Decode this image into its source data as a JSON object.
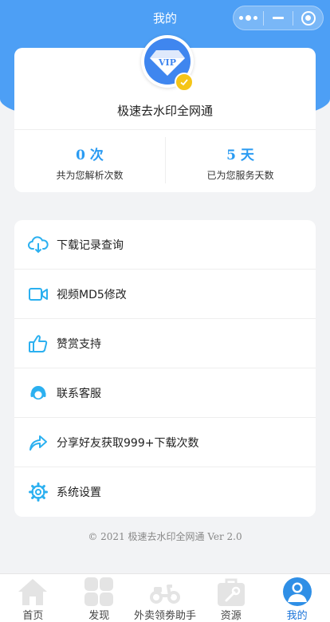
{
  "navbar": {
    "title": "我的",
    "menu_icon": "more-dots-icon",
    "minimize_icon": "minimize-icon",
    "close_icon": "target-close-icon"
  },
  "profile": {
    "badge_text": "VIP",
    "username": "极速去水印全网通",
    "stats": [
      {
        "value": "0 次",
        "label": "共为您解析次数"
      },
      {
        "value": "5 天",
        "label": "已为您服务天数"
      }
    ]
  },
  "menu": {
    "items": [
      {
        "label": "下载记录查询",
        "icon": "cloud-download-icon"
      },
      {
        "label": "视频MD5修改",
        "icon": "video-camera-icon"
      },
      {
        "label": "赞赏支持",
        "icon": "thumbs-up-icon"
      },
      {
        "label": "联系客服",
        "icon": "customer-service-icon"
      },
      {
        "label": "分享好友获取999+下载次数",
        "icon": "share-icon"
      },
      {
        "label": "系统设置",
        "icon": "gear-icon"
      }
    ]
  },
  "footer": {
    "copyright": "© 2021 极速去水印全网通 Ver 2.0"
  },
  "tabbar": {
    "tabs": [
      {
        "label": "首页",
        "icon": "home-icon",
        "active": false
      },
      {
        "label": "发现",
        "icon": "grid-icon",
        "active": false
      },
      {
        "label": "外卖领劵助手",
        "icon": "scooter-icon",
        "active": false
      },
      {
        "label": "资源",
        "icon": "toolbox-icon",
        "active": false
      },
      {
        "label": "我的",
        "icon": "user-icon",
        "active": true
      }
    ]
  },
  "colors": {
    "primary": "#4d9ff5",
    "accent": "#2a9bf2",
    "icon": "#2bb0f0",
    "verified": "#f5c518",
    "tab_active": "#1a73d9"
  }
}
